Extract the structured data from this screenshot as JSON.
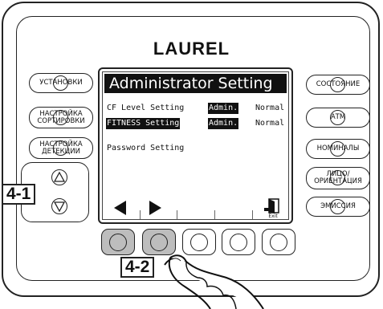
{
  "brand": "LAUREL",
  "left_buttons": [
    "УСТАНОВКИ",
    "НАСТРОЙКА\nСОРТИРОВКИ",
    "НАСТРОЙКА\nДЕТЕКЦИИ"
  ],
  "right_buttons": [
    "СОСТОЯНИЕ",
    "АТМ",
    "НОМИНАЛЫ",
    "ЛИЦО/\nОРИЕНТАЦИЯ",
    "ЭМИССИЯ"
  ],
  "screen": {
    "title": "Administrator Setting",
    "rows": [
      {
        "label": "CF Level Setting",
        "value": "Admin.",
        "option": "Normal"
      },
      {
        "label": "FITNESS Setting",
        "value": "Admin.",
        "option": "Normal"
      },
      {
        "label": "Password Setting"
      }
    ],
    "exit_label": "Exit"
  },
  "callouts": {
    "rocker": "4-1",
    "function_keys": "4-2"
  },
  "function_keys": {
    "count": 5,
    "pressed": [
      1,
      2
    ]
  }
}
